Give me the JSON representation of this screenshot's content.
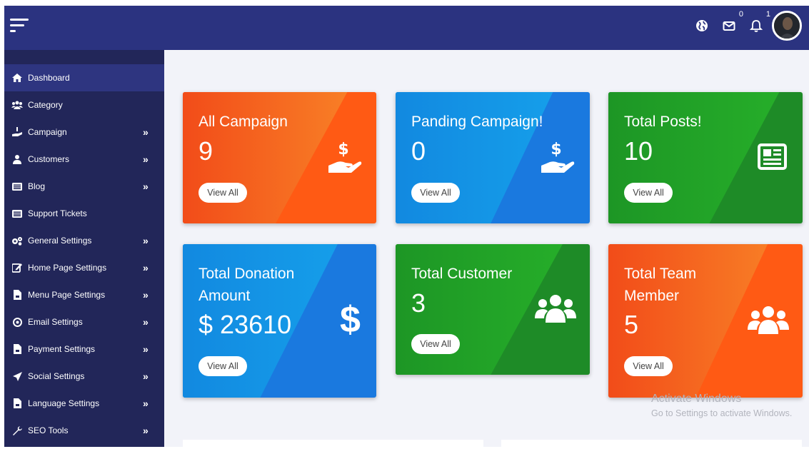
{
  "topbar": {
    "messages_count": "0",
    "notifications_count": "1",
    "icons": [
      "menu-icon",
      "globe-icon",
      "envelope-icon",
      "bell-icon"
    ]
  },
  "sidebar": {
    "items": [
      {
        "label": "Dashboard",
        "icon": "home-icon",
        "active": true,
        "expandable": false
      },
      {
        "label": "Category",
        "icon": "users-icon",
        "active": false,
        "expandable": false
      },
      {
        "label": "Campaign",
        "icon": "hand-holding-dollar-icon",
        "active": false,
        "expandable": true
      },
      {
        "label": "Customers",
        "icon": "user-icon",
        "active": false,
        "expandable": true
      },
      {
        "label": "Blog",
        "icon": "list-icon",
        "active": false,
        "expandable": true
      },
      {
        "label": "Support Tickets",
        "icon": "list-icon",
        "active": false,
        "expandable": false
      },
      {
        "label": "General Settings",
        "icon": "cogs-icon",
        "active": false,
        "expandable": true
      },
      {
        "label": "Home Page Settings",
        "icon": "edit-icon",
        "active": false,
        "expandable": true
      },
      {
        "label": "Menu Page Settings",
        "icon": "file-icon",
        "active": false,
        "expandable": true
      },
      {
        "label": "Email Settings",
        "icon": "at-icon",
        "active": false,
        "expandable": true
      },
      {
        "label": "Payment Settings",
        "icon": "file-icon",
        "active": false,
        "expandable": true
      },
      {
        "label": "Social Settings",
        "icon": "send-icon",
        "active": false,
        "expandable": true
      },
      {
        "label": "Language Settings",
        "icon": "file-icon",
        "active": false,
        "expandable": true
      },
      {
        "label": "SEO Tools",
        "icon": "wrench-icon",
        "active": false,
        "expandable": true
      }
    ],
    "chevron": "»"
  },
  "cards": [
    {
      "title": "All Campaign",
      "value": "9",
      "button": "View All",
      "color": "orange",
      "icon": "hand-holding-dollar-icon"
    },
    {
      "title": "Panding Campaign!",
      "value": "0",
      "button": "View All",
      "color": "blue",
      "icon": "hand-holding-dollar-icon"
    },
    {
      "title": "Total Posts!",
      "value": "10",
      "button": "View All",
      "color": "green",
      "icon": "newspaper-icon"
    },
    {
      "title": "Total Donation Amount",
      "title_line1": "Total Donation",
      "title_line2": "Amount",
      "value": "$ 23610",
      "button": "View All",
      "color": "blue",
      "icon": "dollar-icon"
    },
    {
      "title": "Total Customer",
      "value": "3",
      "button": "View All",
      "color": "green",
      "icon": "users-icon"
    },
    {
      "title": "Total Team Member",
      "title_line1": "Total Team",
      "title_line2": "Member",
      "value": "5",
      "button": "View All",
      "color": "orange",
      "icon": "users-icon"
    }
  ],
  "watermark": {
    "line1": "Activate Windows",
    "line2": "Go to Settings to activate Windows."
  },
  "colors": {
    "topbar": "#2b3380",
    "sidebar": "#222659",
    "sidebar_active": "#2e3580",
    "orange": "#ff5a14",
    "blue": "#1a79df",
    "green": "#1e8b27",
    "content_bg": "#f2f3f9"
  }
}
